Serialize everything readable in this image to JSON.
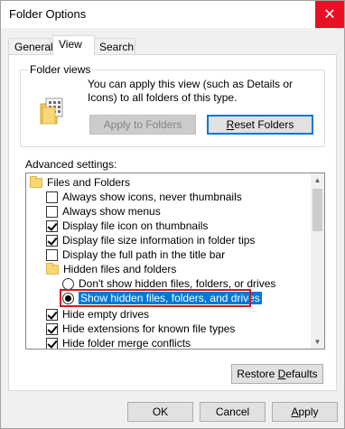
{
  "window": {
    "title": "Folder Options",
    "close_glyph": "✕"
  },
  "tabs": [
    {
      "label": "General",
      "active": false
    },
    {
      "label": "View",
      "active": true
    },
    {
      "label": "Search",
      "active": false
    }
  ],
  "folder_views": {
    "group_label": "Folder views",
    "description": "You can apply this view (such as Details or Icons) to all folders of this type.",
    "apply_button": "Apply to Folders",
    "reset_button": "Reset Folders",
    "reset_underline": "R",
    "reset_rest": "eset Folders"
  },
  "advanced": {
    "label": "Advanced settings:",
    "items": [
      {
        "type": "folder",
        "label": "Files and Folders",
        "indent": 0
      },
      {
        "type": "checkbox",
        "checked": false,
        "label": "Always show icons, never thumbnails",
        "indent": 1
      },
      {
        "type": "checkbox",
        "checked": false,
        "label": "Always show menus",
        "indent": 1
      },
      {
        "type": "checkbox",
        "checked": true,
        "label": "Display file icon on thumbnails",
        "indent": 1
      },
      {
        "type": "checkbox",
        "checked": true,
        "label": "Display file size information in folder tips",
        "indent": 1
      },
      {
        "type": "checkbox",
        "checked": false,
        "label": "Display the full path in the title bar",
        "indent": 1
      },
      {
        "type": "folder",
        "label": "Hidden files and folders",
        "indent": 1
      },
      {
        "type": "radio",
        "checked": false,
        "label": "Don't show hidden files, folders, or drives",
        "indent": 2
      },
      {
        "type": "radio",
        "checked": true,
        "label": "Show hidden files, folders, and drives",
        "indent": 2,
        "selected": true
      },
      {
        "type": "checkbox",
        "checked": true,
        "label": "Hide empty drives",
        "indent": 1
      },
      {
        "type": "checkbox",
        "checked": true,
        "label": "Hide extensions for known file types",
        "indent": 1
      },
      {
        "type": "checkbox",
        "checked": true,
        "label": "Hide folder merge conflicts",
        "indent": 1
      }
    ],
    "restore_button": "Restore Defaults",
    "restore_prefix": "Restore ",
    "restore_underline": "D",
    "restore_rest": "efaults"
  },
  "footer": {
    "ok": "OK",
    "cancel": "Cancel",
    "apply": "Apply",
    "apply_underline": "A",
    "apply_rest": "pply"
  },
  "colors": {
    "selection": "#0078d7",
    "highlight": "#d9151f",
    "close": "#e81123"
  }
}
